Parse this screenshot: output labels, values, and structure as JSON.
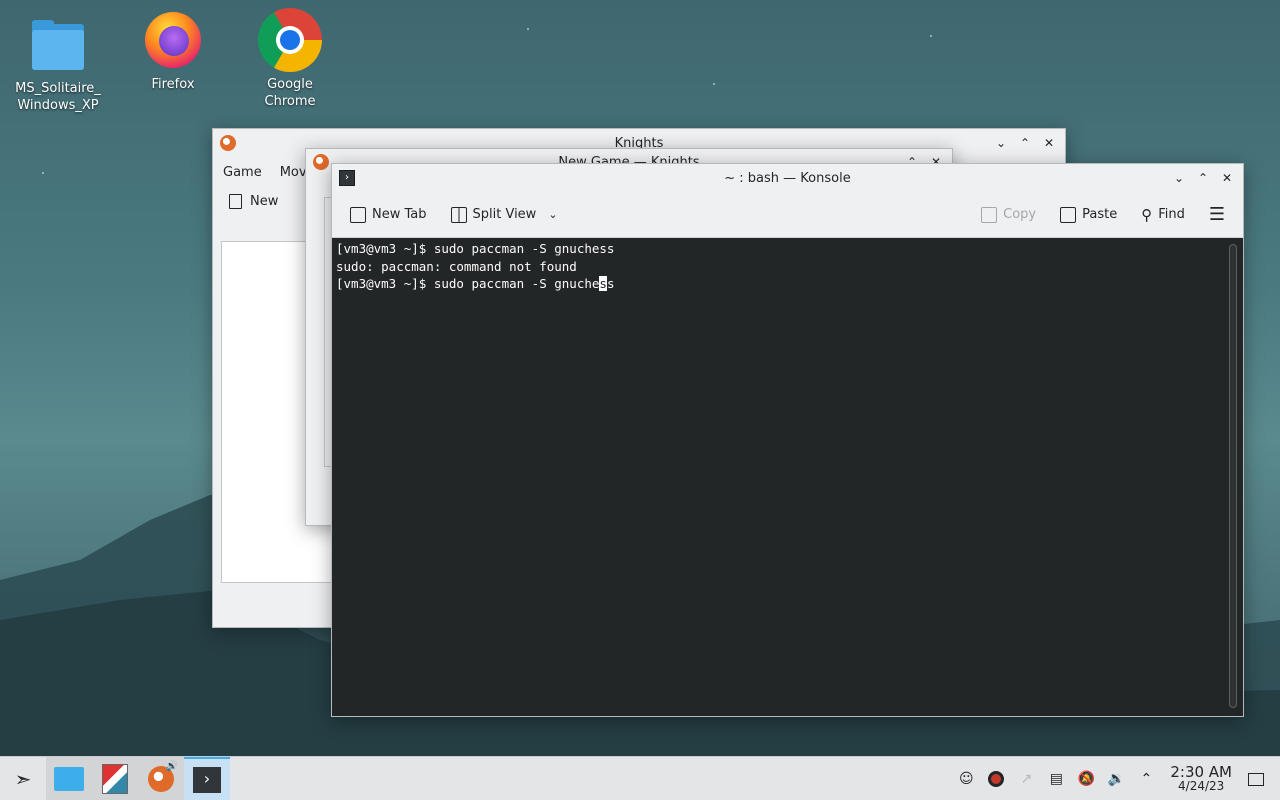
{
  "desktop": {
    "icons": [
      {
        "label": "MS_Solitaire_\nWindows_XP",
        "icon": "folder-icon"
      },
      {
        "label": "Firefox",
        "icon": "firefox-icon"
      },
      {
        "label": "Google Chrome",
        "icon": "chrome-icon"
      }
    ]
  },
  "knights_window": {
    "title": "Knights",
    "menu": [
      "Game",
      "Mov"
    ],
    "toolbar_new": "New"
  },
  "newgame_dialog": {
    "title": "New Game — Knights"
  },
  "konsole": {
    "title": "~ : bash — Konsole",
    "toolbar": {
      "new_tab": "New Tab",
      "split_view": "Split View",
      "copy": "Copy",
      "paste": "Paste",
      "find": "Find"
    },
    "lines": [
      "[vm3@vm3 ~]$ sudo paccman -S gnuchess",
      "sudo: paccman: command not found"
    ],
    "current_line_before": "[vm3@vm3 ~]$ sudo paccman -S gnuche",
    "current_line_cursor": "s",
    "current_line_after": "s"
  },
  "taskbar": {
    "clock_time": "2:30 AM",
    "clock_date": "4/24/23"
  },
  "colors": {
    "accent": "#3daee9",
    "terminal_bg": "#232627"
  }
}
